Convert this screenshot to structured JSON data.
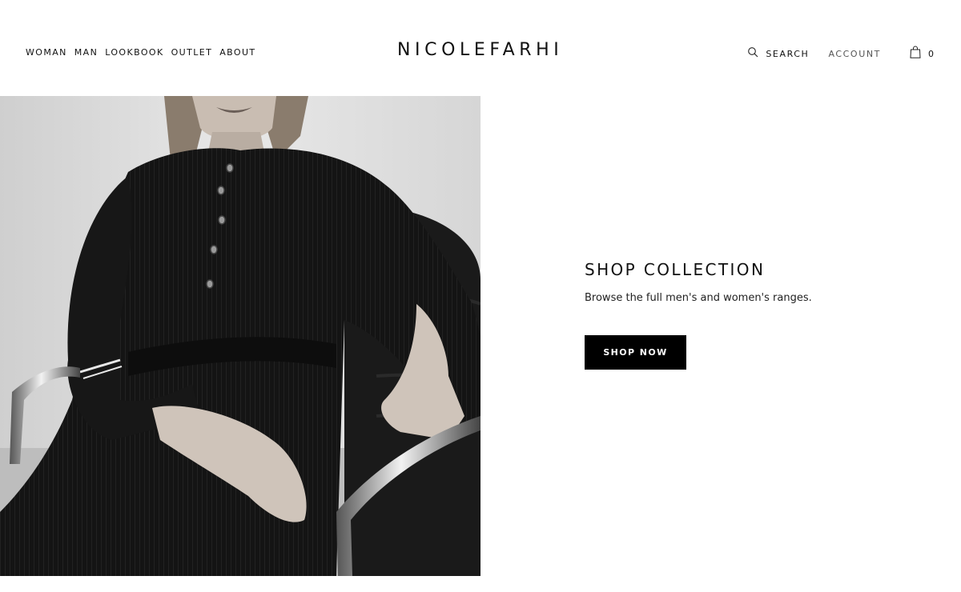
{
  "header": {
    "nav": [
      "WOMAN",
      "MAN",
      "LOOKBOOK",
      "OUTLET",
      "ABOUT"
    ],
    "logo": "NICOLEFARHI",
    "search_label": "SEARCH",
    "account_label": "ACCOUNT",
    "bag_count": "0",
    "icons": {
      "search": "search-icon",
      "bag": "shopping-bag-icon"
    }
  },
  "hero": {
    "image": "woman-black-ribbed-knit-dress-chair-photo"
  },
  "promo": {
    "title": "SHOP COLLECTION",
    "text": "Browse the full men's and women's ranges.",
    "button_label": "SHOP NOW"
  },
  "colors": {
    "text": "#111111",
    "button": "#000000",
    "button_text": "#ffffff",
    "background": "#ffffff"
  }
}
